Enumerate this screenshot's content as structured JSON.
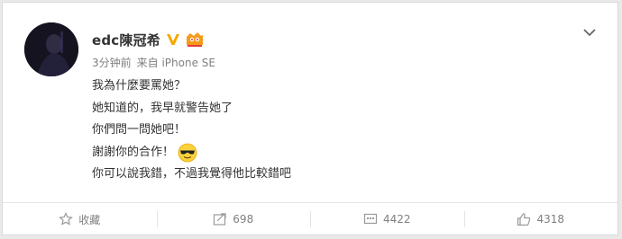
{
  "user": {
    "name": "edc陳冠希"
  },
  "meta": {
    "time": "3分钟前",
    "source": "来自 iPhone SE"
  },
  "post": {
    "lines": [
      "我為什麼要罵她？",
      "她知道的，我早就警告她了",
      "你們問一問她吧！",
      "謝謝你的合作！",
      "你可以說我錯，不過我覺得他比較錯吧"
    ],
    "emoji": "cool-sunglasses-emoji"
  },
  "actions": {
    "favorite": "收藏",
    "repost": "698",
    "comment": "4422",
    "like": "4318"
  },
  "colors": {
    "verify": "#f6a800",
    "text": "#333333",
    "muted": "#808080"
  }
}
